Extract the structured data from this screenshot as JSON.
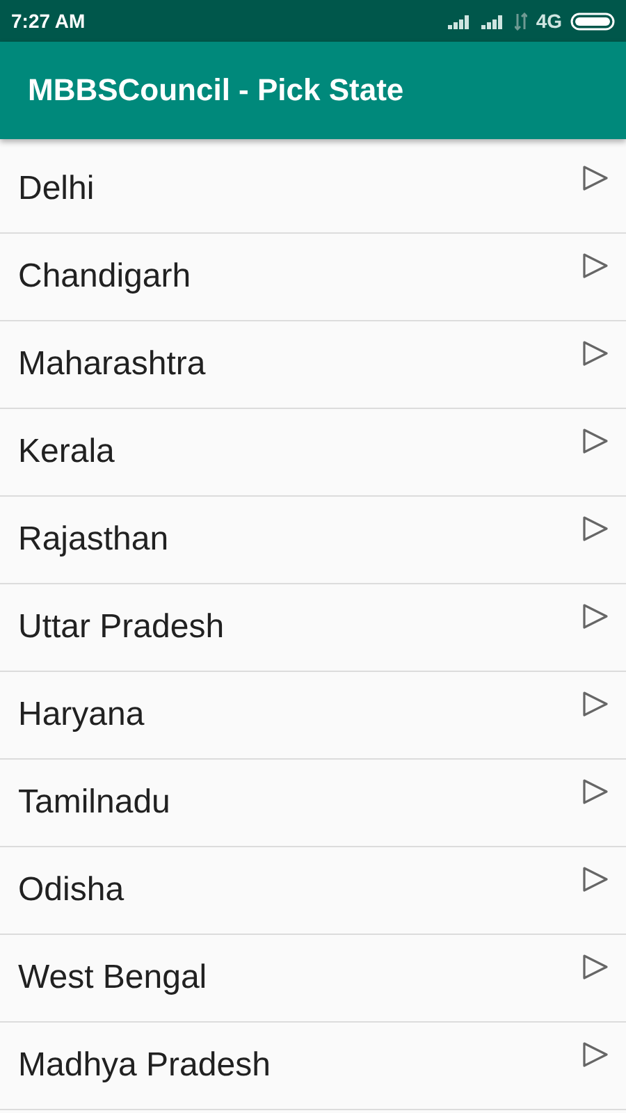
{
  "status_bar": {
    "time": "7:27 AM",
    "network": "4G"
  },
  "app_bar": {
    "title": "MBBSCouncil - Pick State"
  },
  "states": [
    {
      "name": "Delhi"
    },
    {
      "name": "Chandigarh"
    },
    {
      "name": "Maharashtra"
    },
    {
      "name": "Kerala"
    },
    {
      "name": "Rajasthan"
    },
    {
      "name": "Uttar Pradesh"
    },
    {
      "name": "Haryana"
    },
    {
      "name": "Tamilnadu"
    },
    {
      "name": "Odisha"
    },
    {
      "name": "West Bengal"
    },
    {
      "name": "Madhya Pradesh"
    }
  ]
}
